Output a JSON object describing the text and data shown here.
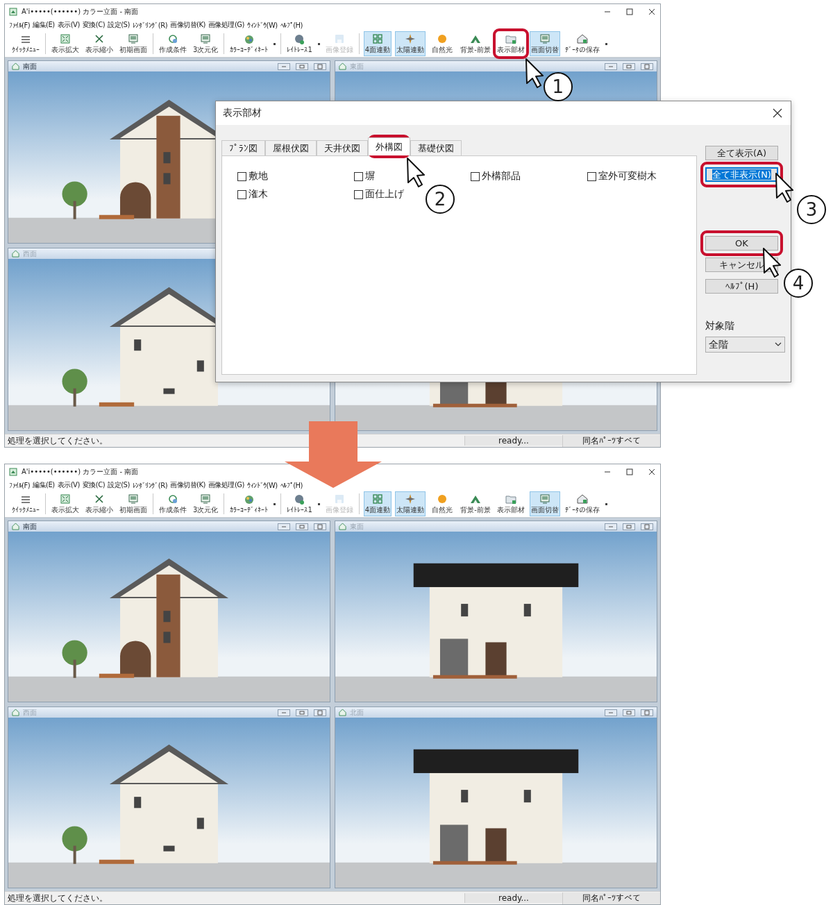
{
  "windows": [
    {
      "title": "A'i•••••(••••••) カラー立面 - 南面",
      "menu": [
        "ﾌｧｲﾙ(F)",
        "編集(E)",
        "表示(V)",
        "変換(C)",
        "設定(S)",
        "ﾚﾝﾀﾞﾘﾝｸﾞ(R)",
        "画像切替(K)",
        "画像処理(G)",
        "ｳｨﾝﾄﾞｳ(W)",
        "ﾍﾙﾌﾟ(H)"
      ],
      "toolbar": [
        {
          "kind": "button",
          "label": "ｸｲｯｸﾒﾆｭｰ",
          "active": false,
          "disabled": false
        },
        {
          "kind": "separator"
        },
        {
          "kind": "button",
          "label": "表示拡大",
          "active": false,
          "disabled": false
        },
        {
          "kind": "button",
          "label": "表示縮小",
          "active": false,
          "disabled": false
        },
        {
          "kind": "button",
          "label": "初期画面",
          "active": false,
          "disabled": false
        },
        {
          "kind": "separator"
        },
        {
          "kind": "button",
          "label": "作成条件",
          "active": false,
          "disabled": false
        },
        {
          "kind": "button",
          "label": "3次元化",
          "active": false,
          "disabled": false
        },
        {
          "kind": "separator"
        },
        {
          "kind": "button",
          "label": "ｶﾗｰｺｰﾃﾞｨﾈｰﾄ",
          "active": false,
          "disabled": false
        },
        {
          "kind": "more"
        },
        {
          "kind": "separator"
        },
        {
          "kind": "button",
          "label": "ﾚｲﾄﾚｰｽ1",
          "active": false,
          "disabled": false
        },
        {
          "kind": "more"
        },
        {
          "kind": "button",
          "label": "画像登録",
          "active": false,
          "disabled": true
        },
        {
          "kind": "separator"
        },
        {
          "kind": "button",
          "label": "4面連動",
          "active": true,
          "disabled": false
        },
        {
          "kind": "button",
          "label": "太陽連動",
          "active": true,
          "disabled": false
        },
        {
          "kind": "button",
          "label": "自然光",
          "active": false,
          "disabled": false
        },
        {
          "kind": "button",
          "label": "背景-前景",
          "active": false,
          "disabled": false
        },
        {
          "kind": "button",
          "label": "表示部材",
          "active": false,
          "disabled": false
        },
        {
          "kind": "button",
          "label": "画面切替",
          "active": true,
          "disabled": false
        },
        {
          "kind": "button",
          "label": "ﾃﾞｰﾀの保存",
          "active": false,
          "disabled": false
        },
        {
          "kind": "more"
        }
      ],
      "panes": [
        {
          "title": "南面",
          "active": true
        },
        {
          "title": "東面",
          "active": false
        },
        {
          "title": "西面",
          "active": false
        }
      ],
      "status_bar": {
        "message": "処理を選択してください。",
        "state": "ready...",
        "mode": "同名ﾊﾟｰﾂすべて"
      }
    },
    {
      "title": "A'i•••••(••••••) カラー立面 - 南面",
      "menu": [
        "ﾌｧｲﾙ(F)",
        "編集(E)",
        "表示(V)",
        "変換(C)",
        "設定(S)",
        "ﾚﾝﾀﾞﾘﾝｸﾞ(R)",
        "画像切替(K)",
        "画像処理(G)",
        "ｳｨﾝﾄﾞｳ(W)",
        "ﾍﾙﾌﾟ(H)"
      ],
      "toolbar": [
        {
          "kind": "button",
          "label": "ｸｲｯｸﾒﾆｭｰ",
          "active": false,
          "disabled": false
        },
        {
          "kind": "separator"
        },
        {
          "kind": "button",
          "label": "表示拡大",
          "active": false,
          "disabled": false
        },
        {
          "kind": "button",
          "label": "表示縮小",
          "active": false,
          "disabled": false
        },
        {
          "kind": "button",
          "label": "初期画面",
          "active": false,
          "disabled": false
        },
        {
          "kind": "separator"
        },
        {
          "kind": "button",
          "label": "作成条件",
          "active": false,
          "disabled": false
        },
        {
          "kind": "button",
          "label": "3次元化",
          "active": false,
          "disabled": false
        },
        {
          "kind": "separator"
        },
        {
          "kind": "button",
          "label": "ｶﾗｰｺｰﾃﾞｨﾈｰﾄ",
          "active": false,
          "disabled": false
        },
        {
          "kind": "more"
        },
        {
          "kind": "separator"
        },
        {
          "kind": "button",
          "label": "ﾚｲﾄﾚｰｽ1",
          "active": false,
          "disabled": false
        },
        {
          "kind": "more"
        },
        {
          "kind": "button",
          "label": "画像登録",
          "active": false,
          "disabled": true
        },
        {
          "kind": "separator"
        },
        {
          "kind": "button",
          "label": "4面連動",
          "active": true,
          "disabled": false
        },
        {
          "kind": "button",
          "label": "太陽連動",
          "active": true,
          "disabled": false
        },
        {
          "kind": "button",
          "label": "自然光",
          "active": false,
          "disabled": false
        },
        {
          "kind": "button",
          "label": "背景-前景",
          "active": false,
          "disabled": false
        },
        {
          "kind": "button",
          "label": "表示部材",
          "active": false,
          "disabled": false
        },
        {
          "kind": "button",
          "label": "画面切替",
          "active": true,
          "disabled": false
        },
        {
          "kind": "button",
          "label": "ﾃﾞｰﾀの保存",
          "active": false,
          "disabled": false
        },
        {
          "kind": "more"
        }
      ],
      "panes": [
        {
          "title": "南面",
          "active": true
        },
        {
          "title": "東面",
          "active": false
        },
        {
          "title": "西面",
          "active": false
        },
        {
          "title": "北面",
          "active": false
        }
      ],
      "status_bar": {
        "message": "処理を選択してください。",
        "state": "ready...",
        "mode": "同名ﾊﾟｰﾂすべて"
      }
    }
  ],
  "dialog": {
    "title": "表示部材",
    "tabs": [
      {
        "label": "ﾌﾟﾗﾝ図",
        "selected": false
      },
      {
        "label": "屋根伏図",
        "selected": false
      },
      {
        "label": "天井伏図",
        "selected": false
      },
      {
        "label": "外構図",
        "selected": true
      },
      {
        "label": "基礎伏図",
        "selected": false
      }
    ],
    "checkboxes": [
      {
        "label": "敷地",
        "checked": false
      },
      {
        "label": "塀",
        "checked": false
      },
      {
        "label": "外構部品",
        "checked": false
      },
      {
        "label": "室外可変樹木",
        "checked": false
      },
      {
        "label": "潅木",
        "checked": false
      },
      {
        "label": "面仕上げ",
        "checked": false
      }
    ],
    "button_groups": [
      [
        {
          "label": "全て表示(A)",
          "focused": false
        },
        {
          "label": "全て非表示(N)",
          "focused": true
        }
      ],
      [
        {
          "label": "OK",
          "focused": false
        },
        {
          "label": "キャンセル",
          "focused": false
        },
        {
          "label": "ﾍﾙﾌﾟ(H)",
          "focused": false
        }
      ]
    ],
    "floor_label": "対象階",
    "floor_select": {
      "value": "全階"
    }
  },
  "callouts": [
    {
      "number": "1"
    },
    {
      "number": "2"
    },
    {
      "number": "3"
    },
    {
      "number": "4"
    }
  ]
}
